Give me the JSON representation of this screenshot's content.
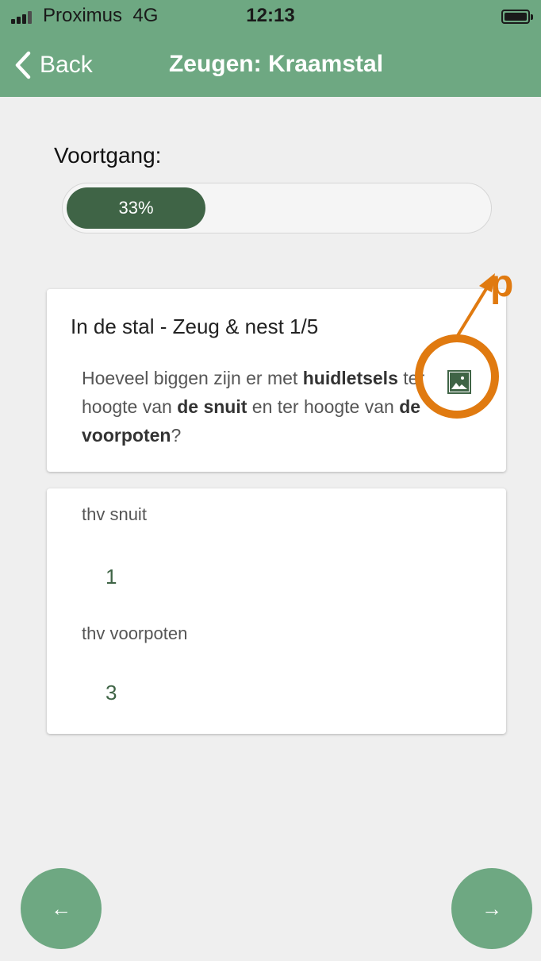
{
  "status_bar": {
    "carrier": "Proximus",
    "network": "4G",
    "time": "12:13"
  },
  "nav": {
    "back_label": "Back",
    "title": "Zeugen: Kraamstal"
  },
  "progress": {
    "label": "Voortgang:",
    "percent_text": "33%",
    "fraction": 0.33
  },
  "question": {
    "title": "In de stal - Zeug & nest 1/5",
    "text_parts": [
      "Hoeveel biggen zijn er met ",
      "huidletsels",
      " ter hoogte van ",
      "de snuit",
      " en ter hoogte van ",
      "de voorpoten",
      "?"
    ],
    "image_icon": "image-icon"
  },
  "answers": [
    {
      "label": "thv snuit",
      "value": "1"
    },
    {
      "label": "thv voorpoten",
      "value": "3"
    }
  ],
  "annotation": {
    "letter": "p",
    "color": "#e07a10"
  },
  "bottom_nav": {
    "prev_symbol": "←",
    "next_symbol": "→"
  },
  "colors": {
    "header": "#6ea882",
    "accent": "#3f6446",
    "background": "#efefef"
  }
}
